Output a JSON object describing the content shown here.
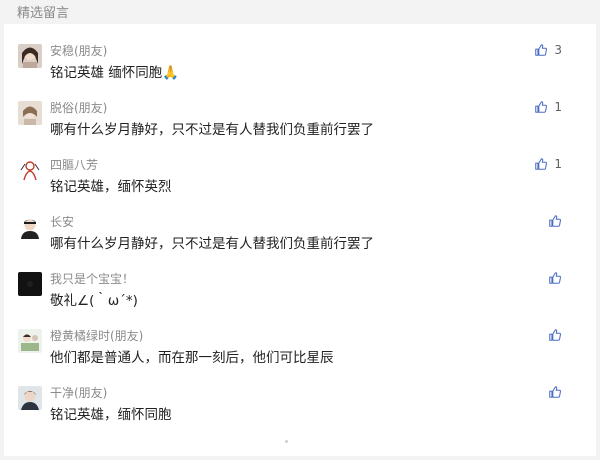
{
  "section_title": "精选留言",
  "comments": [
    {
      "name": "安稳(朋友)",
      "text": "铭记英雄  缅怀同胞🙏",
      "likes": "3"
    },
    {
      "name": "脱俗(朋友)",
      "text": "哪有什么岁月静好，只不过是有人替我们负重前行罢了",
      "likes": "1"
    },
    {
      "name": "四膒八芳",
      "text": "铭记英雄，缅怀英烈",
      "likes": "1"
    },
    {
      "name": "长安",
      "text": "哪有什么岁月静好，只不过是有人替我们负重前行罢了",
      "likes": ""
    },
    {
      "name": "我只是个宝宝！",
      "text": "敬礼∠(｀ω´*)",
      "likes": ""
    },
    {
      "name": "橙黄橘绿时(朋友)",
      "text": "他们都是普通人，而在那一刻后，他们可比星辰",
      "likes": ""
    },
    {
      "name": "干净(朋友)",
      "text": "铭记英雄，缅怀同胞",
      "likes": ""
    }
  ],
  "icons": {
    "like": "thumbs-up-icon"
  },
  "colors": {
    "background": "#f3f3f3",
    "card": "#ffffff",
    "meta_text": "#8a8a8a"
  }
}
